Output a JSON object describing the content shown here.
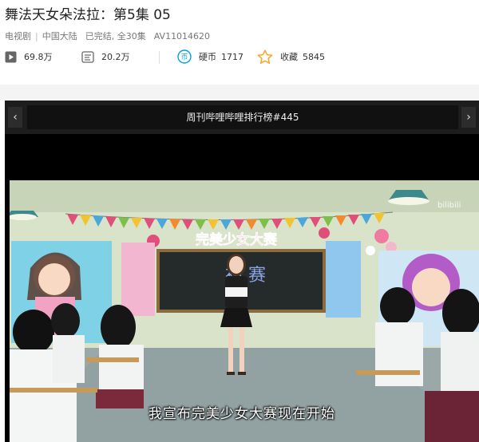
{
  "header": {
    "title": "舞法天女朵法拉：第5集 05",
    "meta": {
      "category": "电视剧",
      "region": "中国大陆",
      "status": "已完结, 全30集",
      "av_id": "AV11014620"
    }
  },
  "stats": {
    "plays": {
      "icon": "play-icon",
      "value": "69.8万"
    },
    "danmaku": {
      "icon": "danmaku-icon",
      "value": "20.2万"
    },
    "coins": {
      "icon": "coin-icon",
      "label": "硬币",
      "value": "1717"
    },
    "favorites": {
      "icon": "star-icon",
      "label": "收藏",
      "value": "5845"
    }
  },
  "player": {
    "ranking_title": "周刊哔哩哔哩排行榜#445",
    "prev_icon": "chevron-left-icon",
    "next_icon": "chevron-right-icon",
    "watermark": "bilibili",
    "subtitle": "我宣布完美少女大赛现在开始",
    "banner_text": "完美少女大赛",
    "blackboard_text": "初 赛"
  },
  "colors": {
    "accent_blue": "#00a1d6",
    "star_orange": "#f5a623",
    "icon_gray": "#555555"
  }
}
